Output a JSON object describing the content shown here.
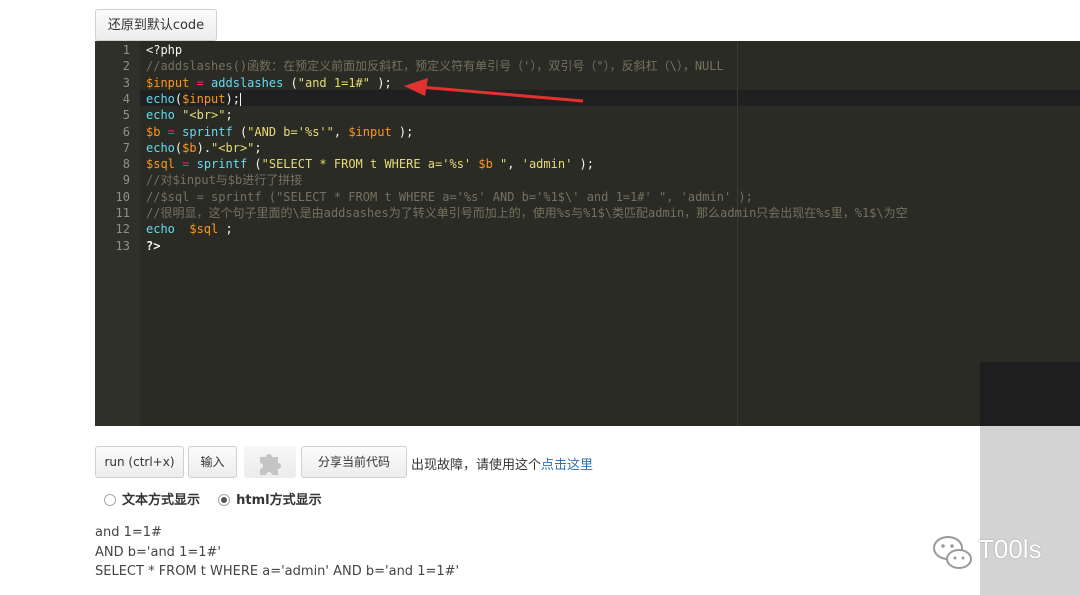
{
  "reset_button": {
    "label": "还原到默认code"
  },
  "editor": {
    "line_numbers": [
      "1",
      "2",
      "3",
      "4",
      "5",
      "6",
      "7",
      "8",
      "9",
      "10",
      "11",
      "12",
      "13"
    ],
    "lines": [
      [
        {
          "t": "<?php",
          "c": "plain"
        }
      ],
      [
        {
          "t": "//addslashes()函数：在预定义前面加反斜杠，预定义符有单引号（'），双引号（\"），反斜杠（\\），NULL",
          "c": "cmt"
        }
      ],
      [
        {
          "t": "$input",
          "c": "var"
        },
        {
          "t": " = ",
          "c": "kw"
        },
        {
          "t": "addslashes",
          "c": "fn"
        },
        {
          "t": " (",
          "c": "plain"
        },
        {
          "t": "\"and 1=1#\"",
          "c": "str"
        },
        {
          "t": " );",
          "c": "plain"
        }
      ],
      [
        {
          "t": "echo",
          "c": "fn"
        },
        {
          "t": "(",
          "c": "plain"
        },
        {
          "t": "$input",
          "c": "var"
        },
        {
          "t": ");",
          "c": "plain"
        },
        {
          "t": "CURSOR",
          "c": "cursor"
        }
      ],
      [
        {
          "t": "echo",
          "c": "fn"
        },
        {
          "t": " ",
          "c": "plain"
        },
        {
          "t": "\"<br>\"",
          "c": "str"
        },
        {
          "t": ";",
          "c": "plain"
        }
      ],
      [
        {
          "t": "$b",
          "c": "var"
        },
        {
          "t": " = ",
          "c": "kw"
        },
        {
          "t": "sprintf",
          "c": "fn"
        },
        {
          "t": " (",
          "c": "plain"
        },
        {
          "t": "\"AND b='%s'\"",
          "c": "str"
        },
        {
          "t": ", ",
          "c": "plain"
        },
        {
          "t": "$input",
          "c": "var"
        },
        {
          "t": " );",
          "c": "plain"
        }
      ],
      [
        {
          "t": "echo",
          "c": "fn"
        },
        {
          "t": "(",
          "c": "plain"
        },
        {
          "t": "$b",
          "c": "var"
        },
        {
          "t": ").",
          "c": "plain"
        },
        {
          "t": "\"<br>\"",
          "c": "str"
        },
        {
          "t": ";",
          "c": "plain"
        }
      ],
      [
        {
          "t": "$sql",
          "c": "var"
        },
        {
          "t": " = ",
          "c": "kw"
        },
        {
          "t": "sprintf",
          "c": "fn"
        },
        {
          "t": " (",
          "c": "plain"
        },
        {
          "t": "\"SELECT * FROM t WHERE a='%s' ",
          "c": "str"
        },
        {
          "t": "$b",
          "c": "var"
        },
        {
          "t": " \"",
          "c": "str"
        },
        {
          "t": ", ",
          "c": "plain"
        },
        {
          "t": "'admin'",
          "c": "str"
        },
        {
          "t": " );",
          "c": "plain"
        }
      ],
      [
        {
          "t": "//对$input与$b进行了拼接",
          "c": "cmt"
        }
      ],
      [
        {
          "t": "//$sql = sprintf (\"SELECT * FROM t WHERE a='%s' AND b='%1$\\' and 1=1#' \", 'admin' );",
          "c": "cmt"
        }
      ],
      [
        {
          "t": "//很明显，这个句子里面的\\是由addsashes为了转义单引号而加上的，使用%s与%1$\\类匹配admin，那么admin只会出现在%s里，%1$\\为空",
          "c": "cmt"
        }
      ],
      [
        {
          "t": "echo",
          "c": "fn"
        },
        {
          "t": "  ",
          "c": "plain"
        },
        {
          "t": "$sql",
          "c": "var"
        },
        {
          "t": " ;",
          "c": "plain"
        }
      ],
      [
        {
          "t": "?>",
          "c": "bold"
        }
      ]
    ]
  },
  "toolbar": {
    "run_label": "run (ctrl+x)",
    "input_label": "输入",
    "share_label": "分享当前代码",
    "trouble_text": "出现故障，请使用这个",
    "trouble_link": "点击这里"
  },
  "display_modes": {
    "text_mode_label": "文本方式显示",
    "html_mode_label": "html方式显示",
    "selected": "html"
  },
  "output": {
    "lines": [
      "and 1=1#",
      "AND b='and 1=1#'",
      "SELECT * FROM t WHERE a='admin' AND b='and 1=1#'"
    ]
  },
  "watermark": {
    "text": "T00ls"
  },
  "colors": {
    "editor_bg": "#2b2b26",
    "gutter_bg": "#2f302a",
    "variable": "#fd971f",
    "function": "#66d9ef",
    "string": "#e6db74",
    "operator": "#f92672",
    "comment": "#75715e",
    "annotation_arrow": "#e3312f",
    "link": "#2f6fb5"
  }
}
